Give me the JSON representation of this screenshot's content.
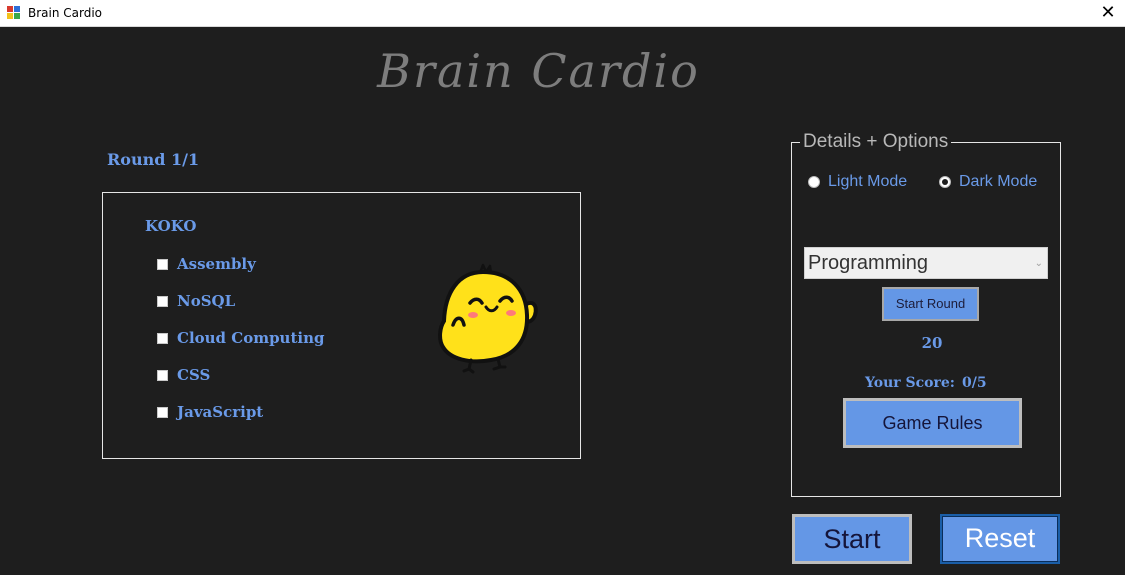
{
  "window": {
    "title": "Brain Cardio",
    "close_glyph": "✕",
    "icon": "app-window-icon"
  },
  "app_title": "Brain Cardio",
  "round_label": "Round 1/1",
  "question": {
    "text": "KOKO",
    "options": [
      {
        "label": "Assembly",
        "checked": false
      },
      {
        "label": "NoSQL",
        "checked": false
      },
      {
        "label": "Cloud Computing",
        "checked": false
      },
      {
        "label": "CSS",
        "checked": false
      },
      {
        "label": "JavaScript",
        "checked": false
      }
    ],
    "mascot": "yellow-chick-mascot"
  },
  "details": {
    "legend": "Details + Options",
    "light_mode_label": "Light Mode",
    "dark_mode_label": "Dark Mode",
    "selected_mode": "Dark Mode",
    "category_value": "Programming",
    "category_chevron": "⌄",
    "start_round_label": "Start Round",
    "timer_value": "20",
    "score_label": "Your Score:",
    "score_value": "0/5",
    "rules_label": "Game Rules"
  },
  "buttons": {
    "start_label": "Start",
    "reset_label": "Reset"
  },
  "colors": {
    "background": "#1e1e1e",
    "accent_blue": "#6a9ae8",
    "button_blue": "#6497e6",
    "title_gray": "#7d7d7d",
    "mascot_yellow": "#ffe11a"
  }
}
